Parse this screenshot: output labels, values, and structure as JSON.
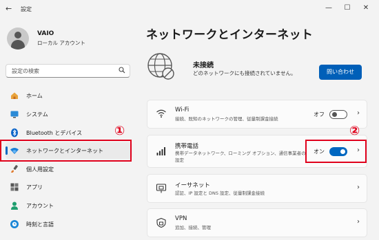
{
  "window": {
    "title": "設定",
    "back_icon": "←",
    "minimize_icon": "—",
    "maximize_icon": "☐",
    "close_icon": "✕"
  },
  "user": {
    "name": "VAIO",
    "account_type": "ローカル アカウント"
  },
  "search": {
    "placeholder": "設定の検索"
  },
  "sidebar": {
    "items": [
      {
        "label": "ホーム",
        "icon": "home-icon"
      },
      {
        "label": "システム",
        "icon": "system-icon"
      },
      {
        "label": "Bluetooth とデバイス",
        "icon": "bluetooth-icon"
      },
      {
        "label": "ネットワークとインターネット",
        "icon": "wifi-icon",
        "active": true
      },
      {
        "label": "個人用設定",
        "icon": "brush-icon"
      },
      {
        "label": "アプリ",
        "icon": "apps-icon"
      },
      {
        "label": "アカウント",
        "icon": "account-icon"
      },
      {
        "label": "時刻と言語",
        "icon": "globe-clock-icon"
      }
    ]
  },
  "annotations": {
    "callout_1": "①",
    "callout_2": "②"
  },
  "main": {
    "title": "ネットワークとインターネット",
    "status": {
      "title": "未接続",
      "subtitle": "どのネットワークにも接続されていません。",
      "button": "問い合わせ"
    },
    "cards": [
      {
        "title": "Wi-Fi",
        "subtitle": "接続、既知のネットワークの管理、従量制課金接続",
        "state": "オフ",
        "toggle_on": false,
        "icon": "wifi-icon"
      },
      {
        "title": "携帯電話",
        "subtitle_line1": "携帯データネットワーク、ローミング オプション、通信事業者の",
        "subtitle_line2": "設定",
        "state": "オン",
        "toggle_on": true,
        "icon": "cellular-icon"
      },
      {
        "title": "イーサネット",
        "subtitle": "認証、IP 設定と DNS 設定、従量制課金接続",
        "icon": "ethernet-icon"
      },
      {
        "title": "VPN",
        "subtitle": "追加、接続、管理",
        "icon": "vpn-icon"
      }
    ]
  },
  "colors": {
    "accent": "#0067c0",
    "button": "#005fb8",
    "annotation": "#e0001b"
  }
}
